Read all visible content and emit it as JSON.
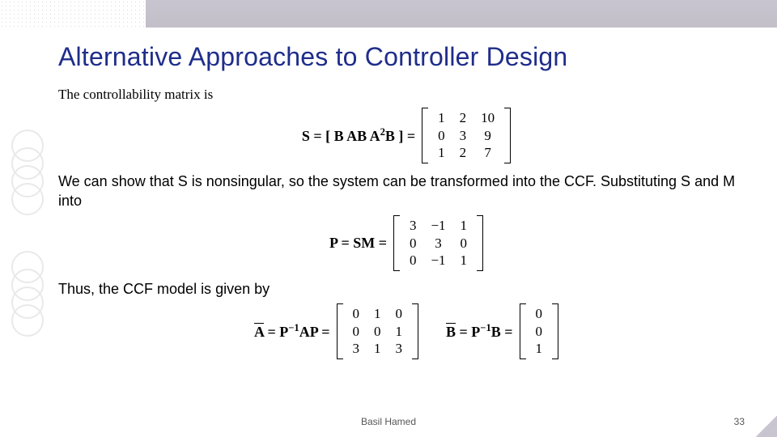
{
  "title": "Alternative Approaches to Controller Design",
  "line1": "The controllability matrix is",
  "eq1": {
    "lhs": "S = [ B  AB  A",
    "sup": "2",
    "lhs2": "B ] =",
    "m": [
      [
        "1",
        "2",
        "10"
      ],
      [
        "0",
        "3",
        "9"
      ],
      [
        "1",
        "2",
        "7"
      ]
    ]
  },
  "para1": "We can show that S is nonsingular, so the system can be transformed into the CCF. Substituting S and M into",
  "eq2": {
    "lhs": "P = SM =",
    "m": [
      [
        "3",
        "−1",
        "1"
      ],
      [
        "0",
        "3",
        "0"
      ],
      [
        "0",
        "−1",
        "1"
      ]
    ]
  },
  "para2": "Thus, the CCF model is given by",
  "eq3": {
    "a_lhs1": "A",
    "a_lhs2": " = P",
    "a_sup": "−1",
    "a_lhs3": "AP =",
    "A": [
      [
        "0",
        "1",
        "0"
      ],
      [
        "0",
        "0",
        "1"
      ],
      [
        "3",
        "1",
        "3"
      ]
    ],
    "b_lhs1": "B",
    "b_lhs2": " = P",
    "b_sup": "−1",
    "b_lhs3": "B =",
    "B": [
      [
        "0"
      ],
      [
        "0"
      ],
      [
        "1"
      ]
    ]
  },
  "footer": {
    "author": "Basil Hamed",
    "page": "33"
  }
}
